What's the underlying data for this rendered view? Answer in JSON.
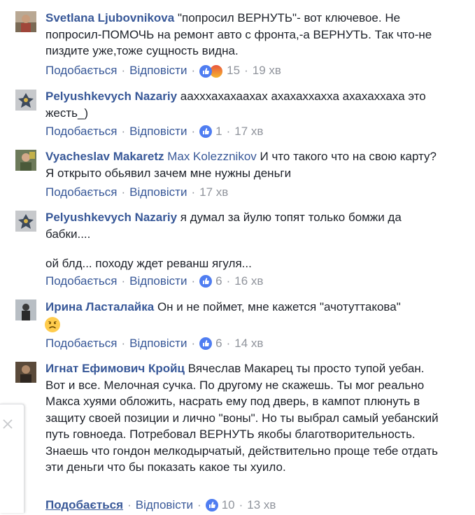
{
  "actions": {
    "like": "Подобається",
    "reply": "Відповісти",
    "separator": "·"
  },
  "colors": {
    "link": "#385898",
    "meta": "#90949c",
    "like_blue": "#4f7df1"
  },
  "comments": [
    {
      "author": "Svetlana Ljubovnikova",
      "text": "\"попросил ВЕРНУТЬ\"- вот ключевое. Не попросил-ПОМОЧЬ на ремонт авто с фронта,-а ВЕРНУТЬ. Так что-не пиздите уже,тоже сущность видна.",
      "reactions": [
        "like-icon",
        "angry-icon"
      ],
      "count": "15",
      "time": "19 хв"
    },
    {
      "author": "Pelyushkevych Nazariy",
      "text": "аахххахахаахах ахахаххахха ахахаххаха это жесть_)",
      "reactions": [
        "like-icon"
      ],
      "count": "1",
      "time": "17 хв"
    },
    {
      "author": "Vyacheslav Makaretz",
      "mention": "Max Kolezznikov",
      "text": "И что такого что на свою карту? Я открыто обьявил зачем мне нужны деньги",
      "time": "17 хв"
    },
    {
      "author": "Pelyushkevych Nazariy",
      "text": "я думал за йулю топят только бомжи да бабки....",
      "text2": "ой блд... походу ждет реванш ягуля...",
      "reactions": [
        "like-icon"
      ],
      "count": "6",
      "time": "16 хв"
    },
    {
      "author": "Ирина Ласталайка",
      "text": "Он и не поймет, мне кажется \"ачотуттакова\"",
      "emoji": "sad-face-icon",
      "reactions": [
        "like-icon"
      ],
      "count": "6",
      "time": "14 хв"
    },
    {
      "author": "Игнат Ефимович Кройц",
      "text": "Вячеслав Макарец ты просто тупой уебан. Вот и все. Мелочная сучка. По другому не скажешь. Ты мог реально Макса хуями обложить, насрать ему под дверь, в кампот плюнуть в защиту своей позиции и лично \"воны\". Но ты выбрал самый уебанский путь говноеда. Потребовал ВЕРНУТЬ якобы благотворительность. Знаешь что гондон мелкодырчатый, действительно проще тебе отдать эти деньги что бы показать какое ты хуило.",
      "reactions": [
        "like-icon"
      ],
      "count": "10",
      "time": "13 хв"
    }
  ],
  "close_panel": {
    "icon": "close-icon"
  }
}
